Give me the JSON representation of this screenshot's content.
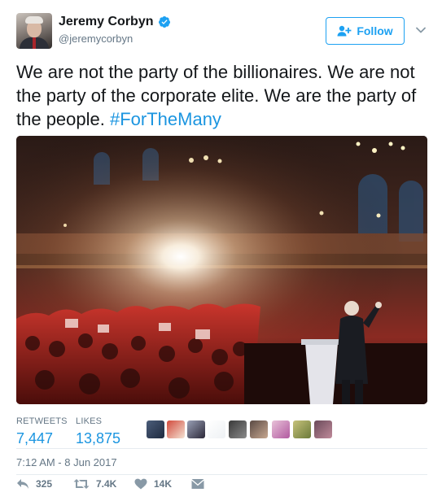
{
  "author": {
    "display_name": "Jeremy Corbyn",
    "handle": "@jeremycorbyn",
    "verified": true
  },
  "follow_button": {
    "label": "Follow"
  },
  "tweet": {
    "text": "We are not the party of the billionaires. We are not the party of the corporate elite. We are the party of the people. ",
    "hashtag": "#ForTheMany"
  },
  "stats": {
    "retweets_label": "RETWEETS",
    "retweets_value": "7,447",
    "likes_label": "LIKES",
    "likes_value": "13,875"
  },
  "timestamp": "7:12 AM - 8 Jun 2017",
  "actions": {
    "reply_count": "325",
    "retweet_count": "7.4K",
    "like_count": "14K"
  },
  "colors": {
    "accent": "#1da1f2",
    "link": "#1b95e0",
    "muted": "#657786",
    "divider": "#e6ecf0"
  },
  "icons": [
    "verified-badge-icon",
    "follow-user-icon",
    "chevron-down-icon",
    "reply-icon",
    "retweet-icon",
    "heart-icon",
    "direct-message-icon"
  ]
}
